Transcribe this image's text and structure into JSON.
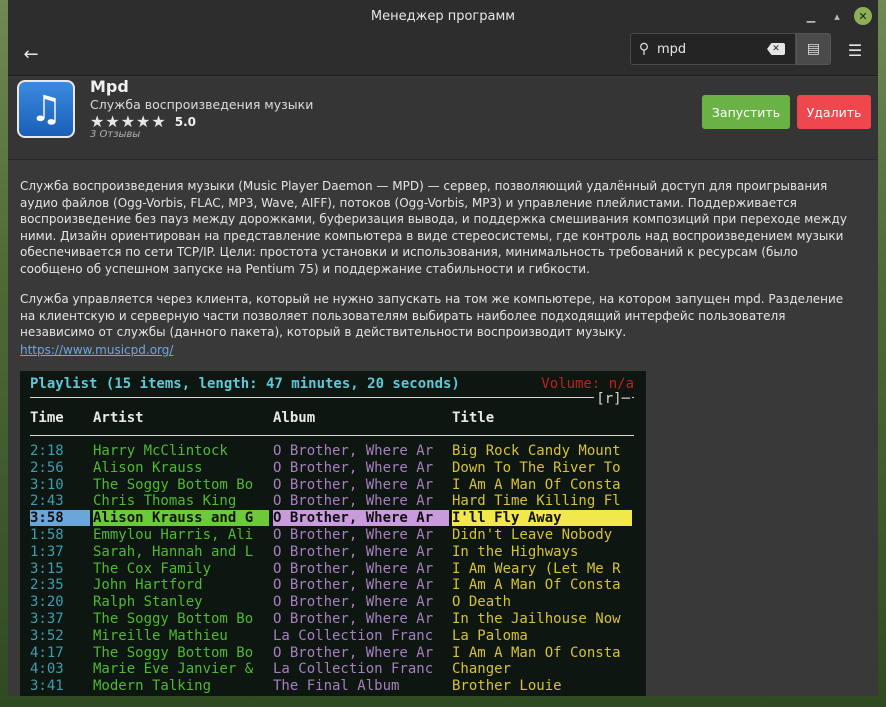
{
  "window": {
    "title": "Менеджер программ"
  },
  "header": {
    "search_value": "mpd"
  },
  "app": {
    "name": "Mpd",
    "summary": "Служба воспроизведения музыки",
    "stars": "★★★★★",
    "score": "5.0",
    "reviews": "3 Отзывы",
    "launch_label": "Запустить",
    "remove_label": "Удалить",
    "launch_color": "#6ab245",
    "remove_color": "#f0474f"
  },
  "description": {
    "paragraph1": "Служба воспроизведения музыки (Music Player Daemon — MPD) — сервер, позволяющий удалённый доступ для проигрывания аудио файлов (Ogg-Vorbis, FLAC, MP3, Wave, AIFF), потоков (Ogg-Vorbis, MP3) и управление плейлистами. Поддерживается воспроизведение без пауз между дорожками, буферизация вывода, и поддержка смешивания композиций при переходе между ними. Дизайн ориентирован на представление компьютера в виде стереосистемы, где контроль над воспроизведением музыки обеспечивается по сети TCP/IP. Цели: простота установки и использования, минимальность требований к ресурсам (было сообщено об успешном запуске на Pentium 75) и поддержание стабильности и гибкости.",
    "paragraph2": "Служба управляется через клиента, который не нужно запускать на том же компьютере, на котором запущен mpd. Разделение на клиентскую и серверную части позволяет пользователям выбирать наиболее подходящий интерфейс пользователя независимо от службы (данного пакета), который в действительности воспроизводит музыку.",
    "link": "https://www.musicpd.org/"
  },
  "screenshot": {
    "header": "Playlist (15 items, length: 47 minutes, 20 seconds)",
    "volume": "Volume: n/a",
    "r_marker": "[r]─",
    "columns": {
      "time": "Time",
      "artist": "Artist",
      "album": "Album",
      "title": "Title"
    },
    "rows": [
      {
        "time": "2:18",
        "artist": "Harry McClintock",
        "album": "O Brother, Where Ar",
        "title": "Big Rock Candy Mount"
      },
      {
        "time": "2:56",
        "artist": "Alison Krauss",
        "album": "O Brother, Where Ar",
        "title": "Down To The River To"
      },
      {
        "time": "3:10",
        "artist": "The Soggy Bottom Bo",
        "album": "O Brother, Where Ar",
        "title": "I Am A Man Of Consta"
      },
      {
        "time": "2:43",
        "artist": "Chris Thomas King",
        "album": "O Brother, Where Ar",
        "title": "Hard Time Killing Fl"
      },
      {
        "time": "3:58",
        "artist": "Alison Krauss and G",
        "album": "O Brother, Where Ar",
        "title": "I'll Fly Away"
      },
      {
        "time": "1:58",
        "artist": "Emmylou Harris, Ali",
        "album": "O Brother, Where Ar",
        "title": "Didn't Leave Nobody"
      },
      {
        "time": "1:37",
        "artist": "Sarah, Hannah and L",
        "album": "O Brother, Where Ar",
        "title": "In the Highways"
      },
      {
        "time": "3:15",
        "artist": "The Cox Family",
        "album": "O Brother, Where Ar",
        "title": "I Am Weary (Let Me R"
      },
      {
        "time": "2:35",
        "artist": "John Hartford",
        "album": "O Brother, Where Ar",
        "title": "I Am A Man Of Consta"
      },
      {
        "time": "3:20",
        "artist": "Ralph Stanley",
        "album": "O Brother, Where Ar",
        "title": "O Death"
      },
      {
        "time": "3:37",
        "artist": "The Soggy Bottom Bo",
        "album": "O Brother, Where Ar",
        "title": "In the Jailhouse Now"
      },
      {
        "time": "3:52",
        "artist": "Mireille Mathieu",
        "album": "La Collection Franc",
        "title": "La Paloma"
      },
      {
        "time": "4:17",
        "artist": "The Soggy Bottom Bo",
        "album": "O Brother, Where Ar",
        "title": "I Am A Man Of Consta"
      },
      {
        "time": "4:03",
        "artist": "Marie Eve Janvier &",
        "album": "La Collection Franc",
        "title": "Changer"
      },
      {
        "time": "3:41",
        "artist": "Modern Talking",
        "album": "The Final Album",
        "title": "Brother Louie"
      }
    ]
  }
}
